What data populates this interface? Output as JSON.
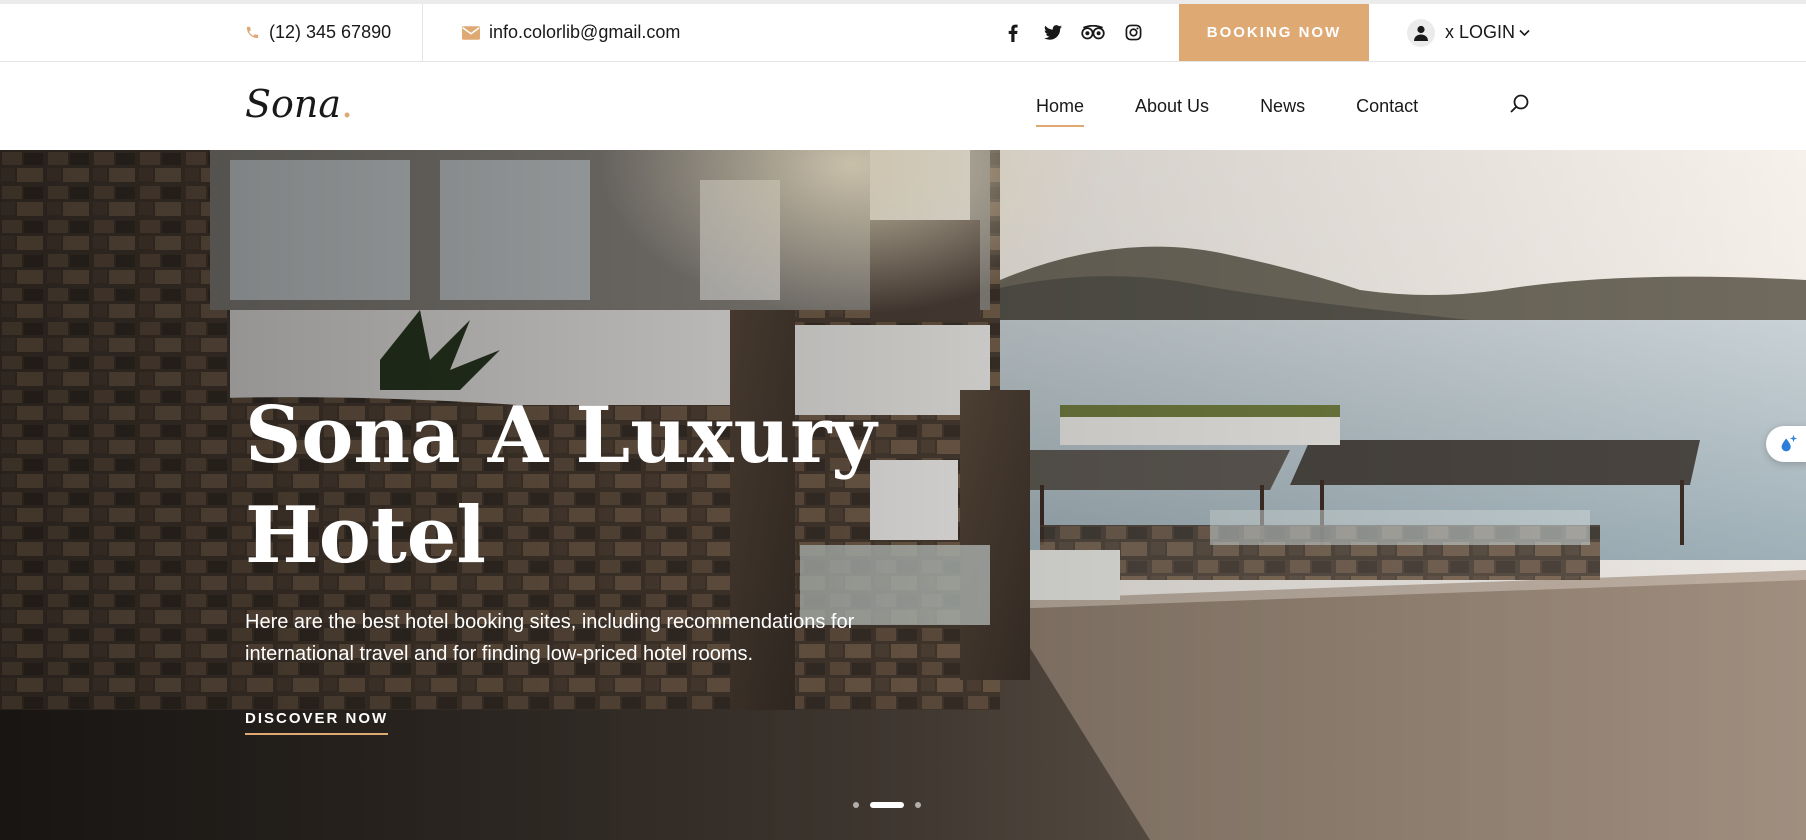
{
  "topbar": {
    "phone": "(12) 345 67890",
    "email": "info.colorlib@gmail.com",
    "socials": [
      "facebook-icon",
      "twitter-icon",
      "tripadvisor-icon",
      "instagram-icon"
    ],
    "booking_label": "BOOKING NOW",
    "login_label": "x LOGIN"
  },
  "nav": {
    "logo_text": "Sona",
    "logo_dot": ".",
    "items": [
      {
        "label": "Home",
        "active": true
      },
      {
        "label": "About Us"
      },
      {
        "label": "News"
      },
      {
        "label": "Contact"
      }
    ]
  },
  "hero": {
    "title": "Sona A Luxury Hotel",
    "text": "Here are the best hotel booking sites, including recommendations for international travel and for finding low-priced hotel rooms.",
    "cta_label": "DISCOVER NOW",
    "slides_count": 3,
    "active_slide": 2
  },
  "colors": {
    "accent": "#dfa974",
    "text_dark": "#19191a"
  }
}
